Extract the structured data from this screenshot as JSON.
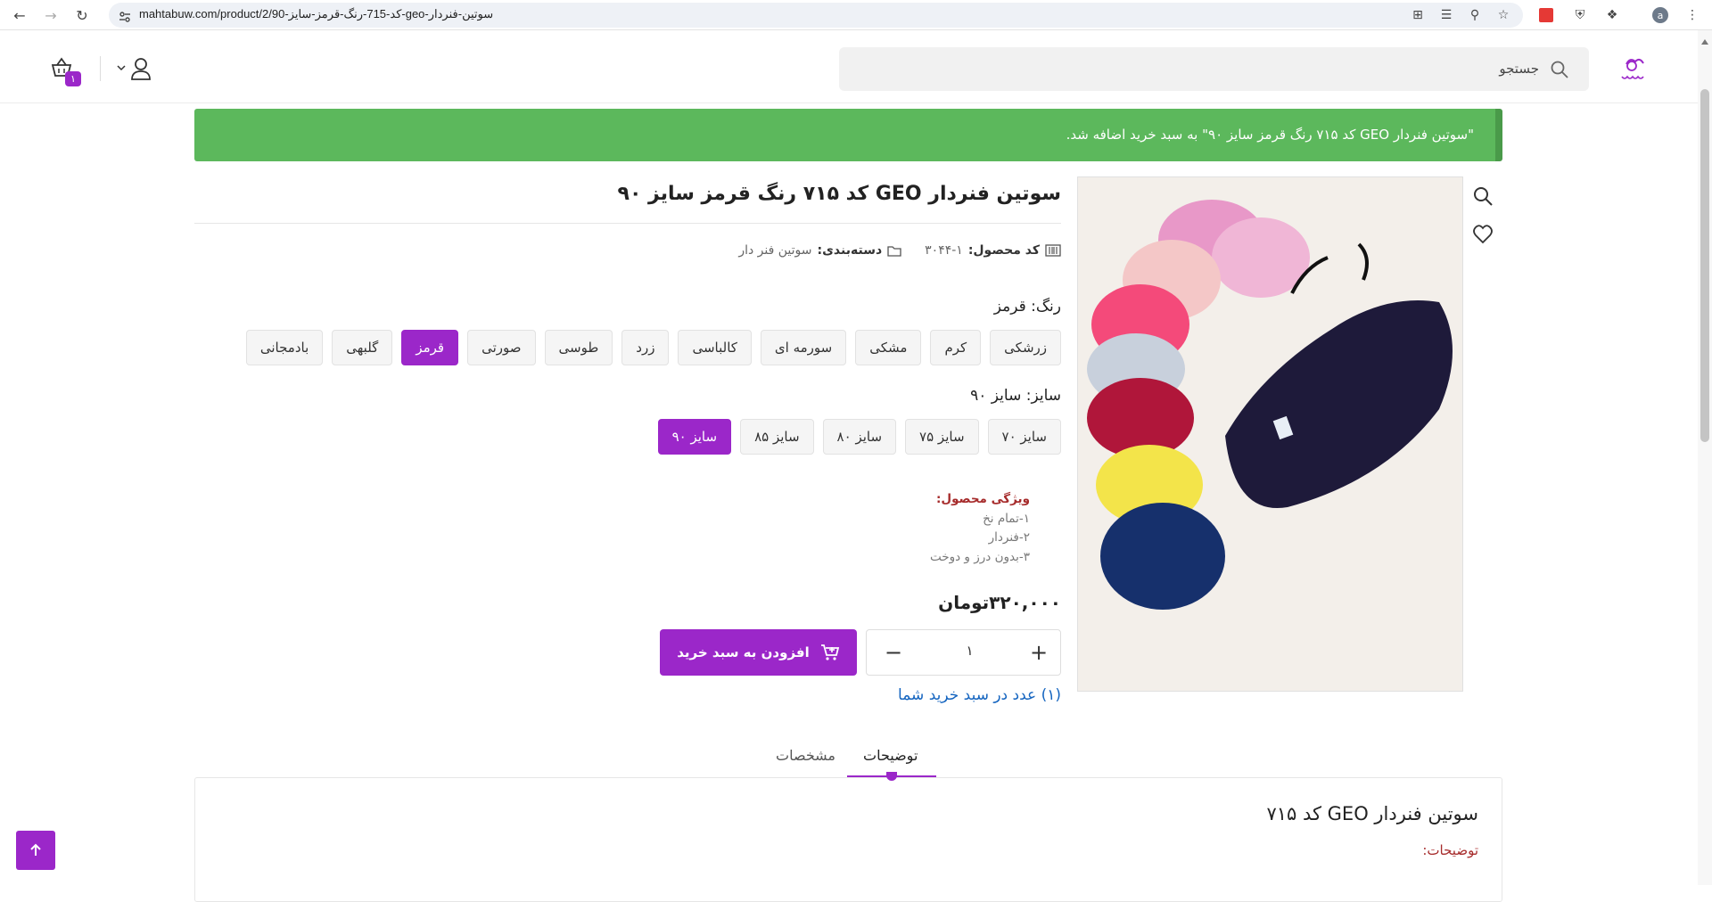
{
  "browser": {
    "url": "mahtabuw.com/product/2/کد-715-رنگ-قرمز-سایز-90-geo-سوتین-فنردار",
    "profile_initial": "a"
  },
  "header": {
    "search_placeholder": "جستجو",
    "cart_count": "۱"
  },
  "notice": {
    "text": "\"سوتین فنردار GEO کد ۷۱۵ رنگ قرمز سایز ۹۰\" به سبد خرید اضافه شد."
  },
  "product": {
    "title": "سوتین فنردار GEO کد ۷۱۵ رنگ قرمز سایز ۹۰",
    "sku_label": "کد محصول:",
    "sku_value": "۳۰۴۴-۱",
    "category_label": "دسته‌بندی:",
    "category_value": "سوتین فنر دار",
    "color_label": "رنگ: قرمز",
    "colors": [
      "زرشکی",
      "کرم",
      "مشکی",
      "سورمه ای",
      "کالباسی",
      "زرد",
      "طوسی",
      "صورتی",
      "قرمز",
      "گلبهی",
      "بادمجانی"
    ],
    "selected_color": "قرمز",
    "size_label": "سایز: سایز ۹۰",
    "sizes": [
      "سایز ۷۰",
      "سایز ۷۵",
      "سایز ۸۰",
      "سایز ۸۵",
      "سایز ۹۰"
    ],
    "selected_size": "سایز ۹۰",
    "features_title": "ویژگی محصول:",
    "features": [
      "۱-تمام نخ",
      "۲-فنردار",
      "۳-بدون درز و دوخت"
    ],
    "price": "۳۲۰,۰۰۰تومان",
    "quantity": "۱",
    "add_to_cart_label": "افزودن به سبد خرید",
    "in_cart_text": "(۱) عدد در سبد خرید شما"
  },
  "tabs": {
    "description": "توضیحات",
    "specs": "مشخصات"
  },
  "description": {
    "title": "سوتین فنردار GEO کد ۷۱۵",
    "subtitle": "توضیحات:"
  },
  "colors": {
    "accent": "#9b27c9",
    "success": "#5cb85c",
    "link": "#1565c0"
  }
}
